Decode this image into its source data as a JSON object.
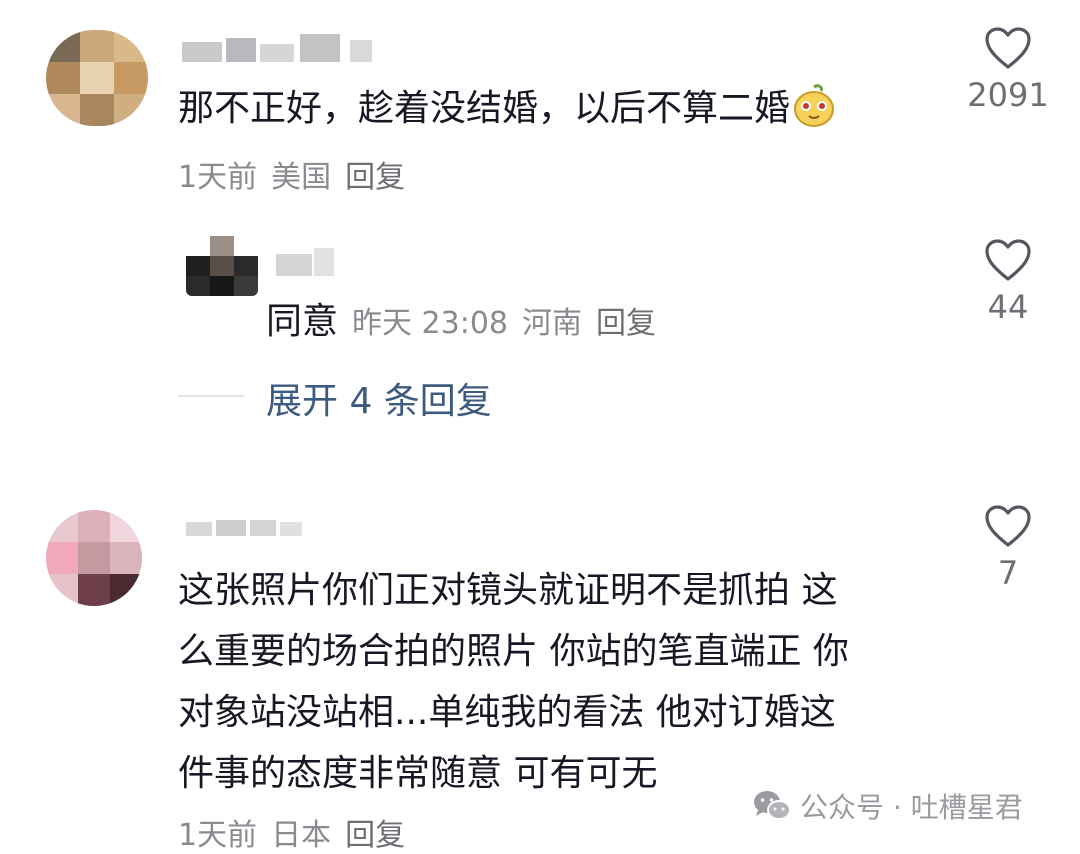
{
  "comments": [
    {
      "text": "那不正好，趁着没结婚，以后不算二婚",
      "emoji": "smirk-pear-emoji",
      "time": "1天前",
      "location": "美国",
      "reply_label": "回复",
      "likes": "2091"
    },
    {
      "text_lines": [
        "这张照片你们正对镜头就证明不是抓拍 这",
        "么重要的场合拍的照片 你站的笔直端正 你",
        "对象站没站相...单纯我的看法 他对订婚这",
        "件事的态度非常随意 可有可无"
      ],
      "time": "1天前",
      "location": "日本",
      "reply_label": "回复",
      "likes": "7"
    }
  ],
  "reply": {
    "text": "同意",
    "time": "昨天 23:08",
    "location": "河南",
    "reply_label": "回复",
    "likes": "44"
  },
  "expand_label": "展开 4 条回复",
  "watermark": {
    "icon": "wechat-icon",
    "text": "公众号 · 吐槽星君"
  },
  "colors": {
    "text": "#161823",
    "meta": "#8a8b91",
    "link": "#3d5a80",
    "heart_stroke": "#555760"
  }
}
